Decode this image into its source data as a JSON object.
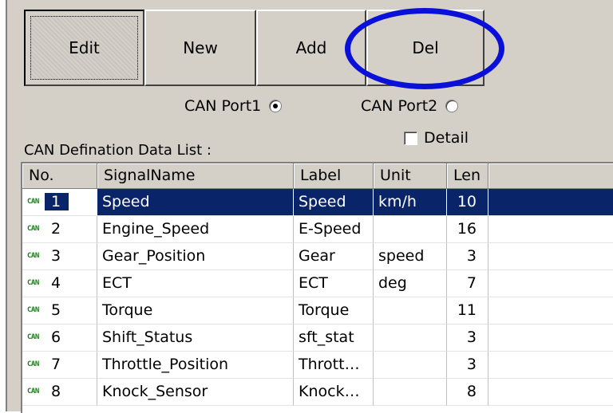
{
  "toolbar": {
    "buttons": [
      {
        "label": "Edit"
      },
      {
        "label": "New"
      },
      {
        "label": "Add"
      },
      {
        "label": "Del"
      }
    ]
  },
  "ports": {
    "port1_label": "CAN Port1",
    "port1_selected": true,
    "port2_label": "CAN Port2",
    "port2_selected": false
  },
  "detail": {
    "label": "Detail",
    "checked": false
  },
  "list": {
    "title": "CAN Defination Data List :",
    "columns": [
      "No.",
      "SignalName",
      "Label",
      "Unit",
      "Len"
    ],
    "icon_text": "CAN",
    "rows": [
      {
        "no": "1",
        "name": "Speed",
        "label": "Speed",
        "unit": "km/h",
        "len": "10",
        "selected": true
      },
      {
        "no": "2",
        "name": "Engine_Speed",
        "label": "E-Speed",
        "unit": "",
        "len": "16"
      },
      {
        "no": "3",
        "name": "Gear_Position",
        "label": "Gear",
        "unit": "speed",
        "len": "3"
      },
      {
        "no": "4",
        "name": "ECT",
        "label": "ECT",
        "unit": "deg",
        "len": "7"
      },
      {
        "no": "5",
        "name": "Torque",
        "label": "Torque",
        "unit": "",
        "len": "11"
      },
      {
        "no": "6",
        "name": "Shift_Status",
        "label": "sft_stat",
        "unit": "",
        "len": "3"
      },
      {
        "no": "7",
        "name": "Throttle_Position",
        "label": "Thrott…",
        "unit": "",
        "len": "3"
      },
      {
        "no": "8",
        "name": "Knock_Sensor",
        "label": "Knock…",
        "unit": "",
        "len": "8"
      }
    ]
  },
  "colors": {
    "selection": "#0a246a",
    "annotation_circle": "#0a10d8",
    "can_icon": "#1a7a1a"
  }
}
